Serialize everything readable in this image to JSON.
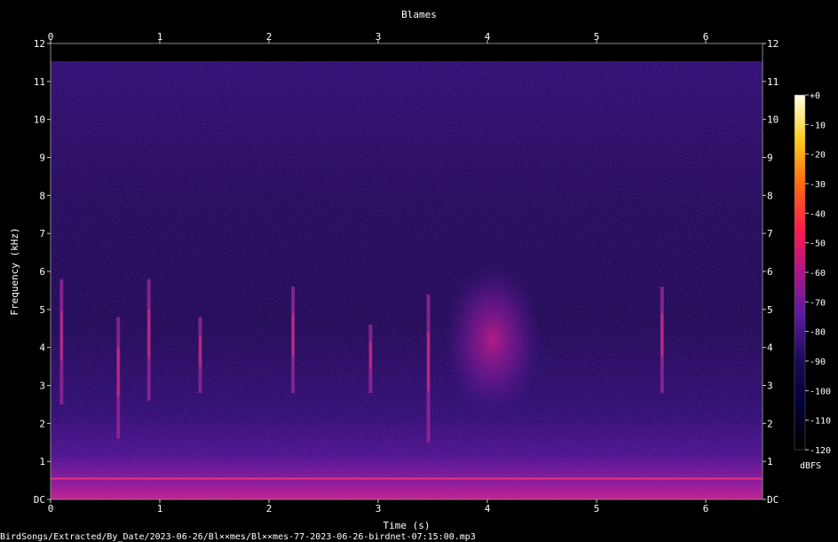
{
  "chart_data": {
    "type": "heatmap",
    "title": "Blames",
    "xlabel": "Time (s)",
    "ylabel": "Frequency (kHz)",
    "xlim": [
      0,
      6.5
    ],
    "ylim": [
      0,
      12
    ],
    "x_ticks": [
      "0",
      "1",
      "2",
      "3",
      "4",
      "5",
      "6"
    ],
    "y_ticks": [
      "DC",
      "1",
      "2",
      "3",
      "4",
      "5",
      "6",
      "7",
      "8",
      "9",
      "10",
      "11",
      "12"
    ],
    "colorbar": {
      "label": "dBFS",
      "ticks": [
        "+0",
        "-10",
        "-20",
        "-30",
        "-40",
        "-50",
        "-60",
        "-70",
        "-80",
        "-90",
        "-100",
        "-110",
        "-120"
      ],
      "range": [
        -120,
        0
      ]
    },
    "calls": [
      {
        "time": 0.1,
        "freq_low": 2.5,
        "freq_high": 5.8
      },
      {
        "time": 0.62,
        "freq_low": 1.6,
        "freq_high": 4.8
      },
      {
        "time": 0.9,
        "freq_low": 2.6,
        "freq_high": 5.8
      },
      {
        "time": 1.37,
        "freq_low": 2.8,
        "freq_high": 4.8
      },
      {
        "time": 2.22,
        "freq_low": 2.8,
        "freq_high": 5.6
      },
      {
        "time": 2.93,
        "freq_low": 2.8,
        "freq_high": 4.6
      },
      {
        "time": 3.46,
        "freq_low": 1.5,
        "freq_high": 5.4
      },
      {
        "time": 5.6,
        "freq_low": 2.8,
        "freq_high": 5.6
      }
    ],
    "bursts": [
      {
        "t_start": 3.6,
        "t_end": 4.5,
        "freq_low": 2.2,
        "freq_high": 6.2
      }
    ],
    "colors": {
      "background": "#000000",
      "low": "#000033",
      "mid": "#5a1aa0",
      "high": "#ff1a6e"
    }
  },
  "footer": {
    "path": "BirdSongs/Extracted/By_Date/2023-06-26/Bl××mes/Bl××mes-77-2023-06-26-birdnet-07:15:00.mp3"
  }
}
